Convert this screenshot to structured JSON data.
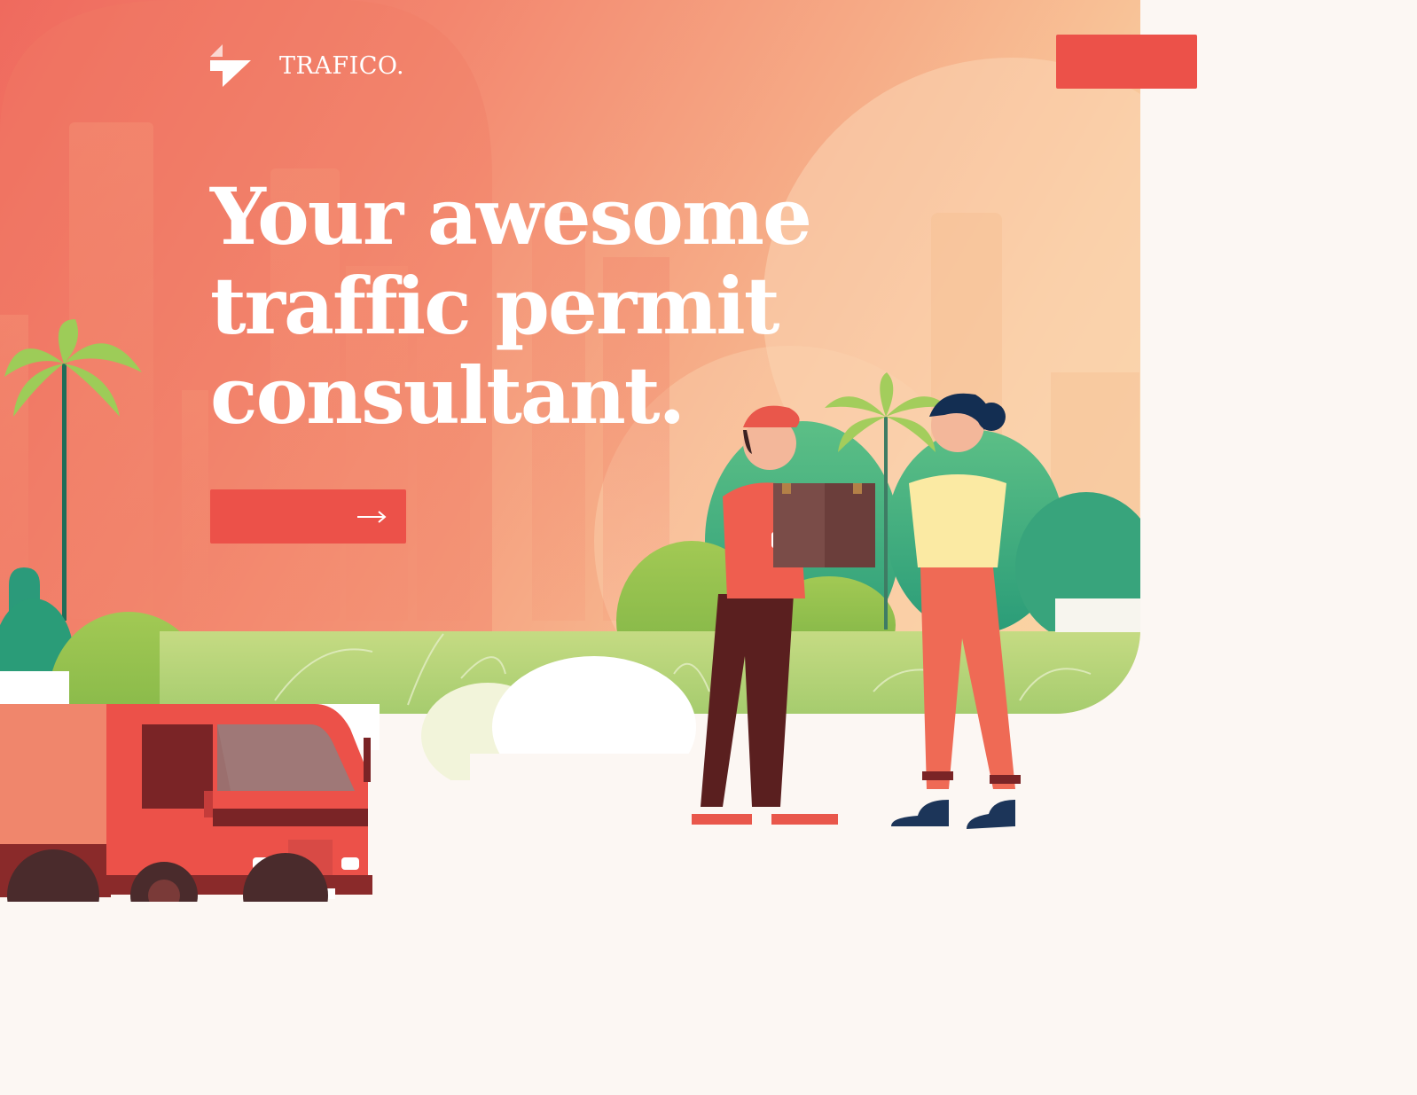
{
  "brand": {
    "name": "TRAFICO.",
    "logo_icon": "trafico-logo-mark"
  },
  "header": {
    "signup_label": ""
  },
  "hero": {
    "title_lines": [
      "Your awesome",
      "traffic permit",
      "consultant."
    ],
    "cta_label": "",
    "cta_icon": "arrow-right-icon"
  },
  "colors": {
    "accent": "#ec5149",
    "hero_gradient_start": "#ef6a5e",
    "hero_gradient_end": "#fad9a8",
    "page_background": "#fcf7f3",
    "grass": "#b8d47a"
  },
  "illustration": {
    "scene": "city-skyline-with-palms",
    "truck": "delivery-truck",
    "people": [
      "courier-with-package",
      "woman-receiving-package"
    ]
  }
}
